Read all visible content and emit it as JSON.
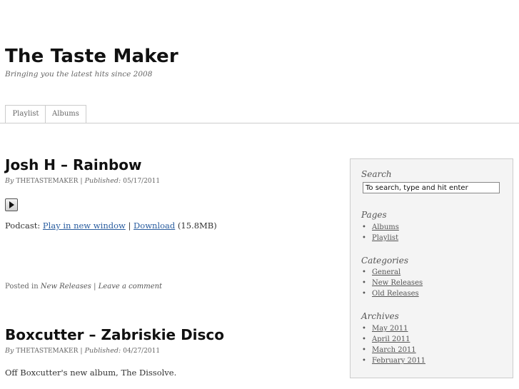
{
  "site": {
    "title": "The Taste Maker",
    "tagline": "Bringing you the latest hits since 2008"
  },
  "nav": {
    "tabs": [
      "Playlist",
      "Albums"
    ]
  },
  "posts": [
    {
      "title": "Josh H – Rainbow",
      "by_label": "By",
      "author": "THETASTEMAKER",
      "sep": "|",
      "published_label": "Published:",
      "date": "05/17/2011",
      "podcast_label": "Podcast:",
      "play_link": "Play in new window",
      "link_sep": "|",
      "download_link": "Download",
      "size": "(15.8MB)",
      "posted_in_label": "Posted in",
      "category": "New Releases",
      "comment_sep": "|",
      "comment_link": "Leave a comment"
    },
    {
      "title": "Boxcutter – Zabriskie Disco",
      "by_label": "By",
      "author": "THETASTEMAKER",
      "sep": "|",
      "published_label": "Published:",
      "date": "04/27/2011",
      "excerpt": "Off Boxcutter's new album, The Dissolve."
    }
  ],
  "sidebar": {
    "search_heading": "Search",
    "search_value": "To search, type and hit enter",
    "pages_heading": "Pages",
    "pages": [
      "Albums",
      "Playlist"
    ],
    "categories_heading": "Categories",
    "categories": [
      "General",
      "New Releases",
      "Old Releases"
    ],
    "archives_heading": "Archives",
    "archives": [
      "May 2011",
      "April 2011",
      "March 2011",
      "February 2011"
    ]
  }
}
